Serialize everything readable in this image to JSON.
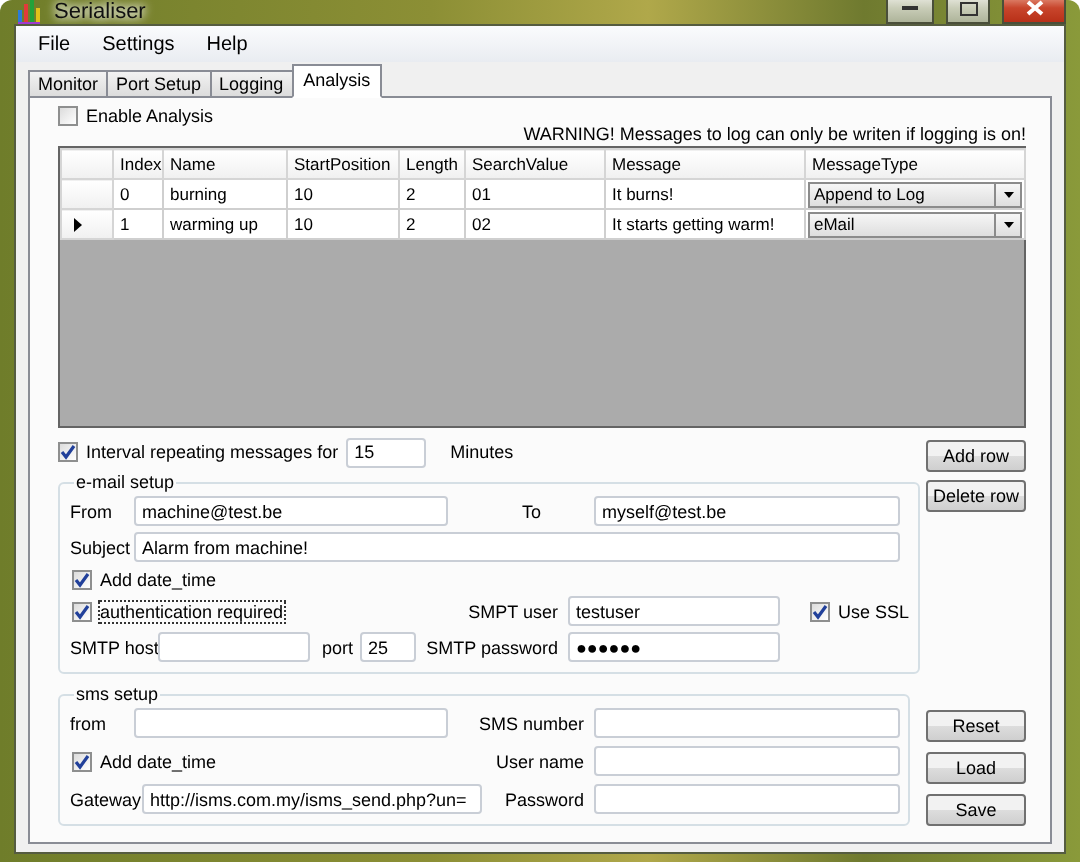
{
  "window": {
    "title": "Serialiser"
  },
  "menu": [
    "File",
    "Settings",
    "Help"
  ],
  "tabs": [
    {
      "label": "Monitor",
      "selected": false
    },
    {
      "label": "Port Setup",
      "selected": false
    },
    {
      "label": "Logging",
      "selected": false
    },
    {
      "label": "Analysis",
      "selected": true
    }
  ],
  "enable_analysis": {
    "label": "Enable Analysis",
    "checked": false
  },
  "warning": "WARNING! Messages to log can only be writen if logging is on!",
  "table": {
    "columns": [
      "Index",
      "Name",
      "StartPosition",
      "Length",
      "SearchValue",
      "Message",
      "MessageType"
    ],
    "rows": [
      {
        "selected": false,
        "cells": [
          "0",
          "burning",
          "10",
          "2",
          "01",
          "It burns!"
        ],
        "message_type": "Append to Log"
      },
      {
        "selected": true,
        "cells": [
          "1",
          "warming up",
          "10",
          "2",
          "02",
          "It starts getting warm!"
        ],
        "message_type": "eMail"
      }
    ]
  },
  "interval": {
    "label": "Interval repeating messages for",
    "checked": true,
    "value": "15",
    "unit": "Minutes"
  },
  "row_buttons": [
    "Add row",
    "Delete row"
  ],
  "email": {
    "title": "e-mail setup",
    "from_label": "From",
    "from": "machine@test.be",
    "to_label": "To",
    "to": "myself@test.be",
    "subject_label": "Subject",
    "subject": "Alarm from machine!",
    "add_date": {
      "label": "Add date_time",
      "checked": true
    },
    "auth": {
      "label": "authentication required",
      "checked": true
    },
    "smtp_user_label": "SMPT user",
    "smtp_user": "testuser",
    "ssl": {
      "label": "Use SSL",
      "checked": true
    },
    "smtp_host_label": "SMTP host",
    "port_label": "port",
    "port": "25",
    "smtp_password_label": "SMTP password",
    "smtp_password": "●●●●●●"
  },
  "sms": {
    "title": "sms setup",
    "from_label": "from",
    "sms_number_label": "SMS number",
    "add_date": {
      "label": "Add date_time",
      "checked": true
    },
    "user_name_label": "User name",
    "gateway_label": "Gateway",
    "gateway": "http://isms.com.my/isms_send.php?un=",
    "password_label": "Password"
  },
  "file_buttons": [
    "Reset",
    "Load",
    "Save"
  ]
}
